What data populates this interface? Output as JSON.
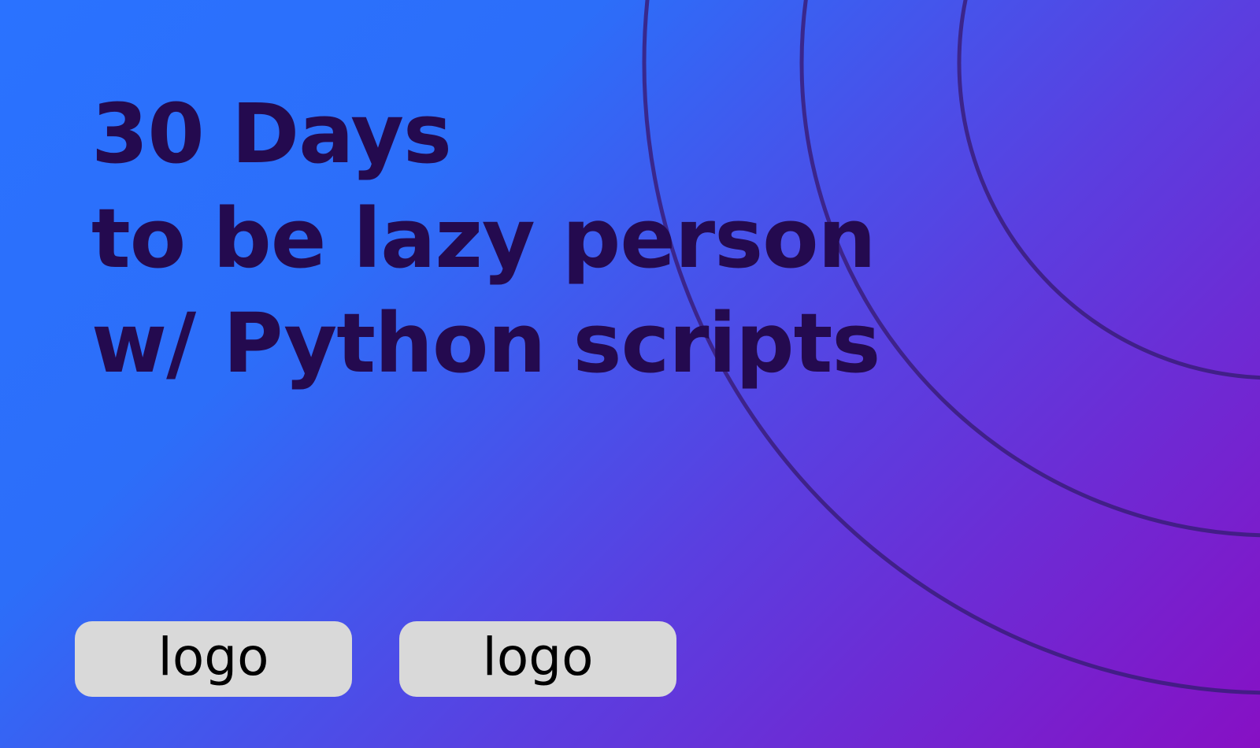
{
  "headline": {
    "line1": "30 Days",
    "line2": "to be lazy person",
    "line3": "w/ Python scripts"
  },
  "logos": [
    {
      "label": "logo"
    },
    {
      "label": "logo"
    }
  ],
  "colors": {
    "gradient_start": "#2a72ff",
    "gradient_end": "#8710c4",
    "headline_text": "#240a4f",
    "ring_stroke": "#3a1d7a",
    "logo_box": "#d9d9d9",
    "logo_text": "#000000"
  }
}
